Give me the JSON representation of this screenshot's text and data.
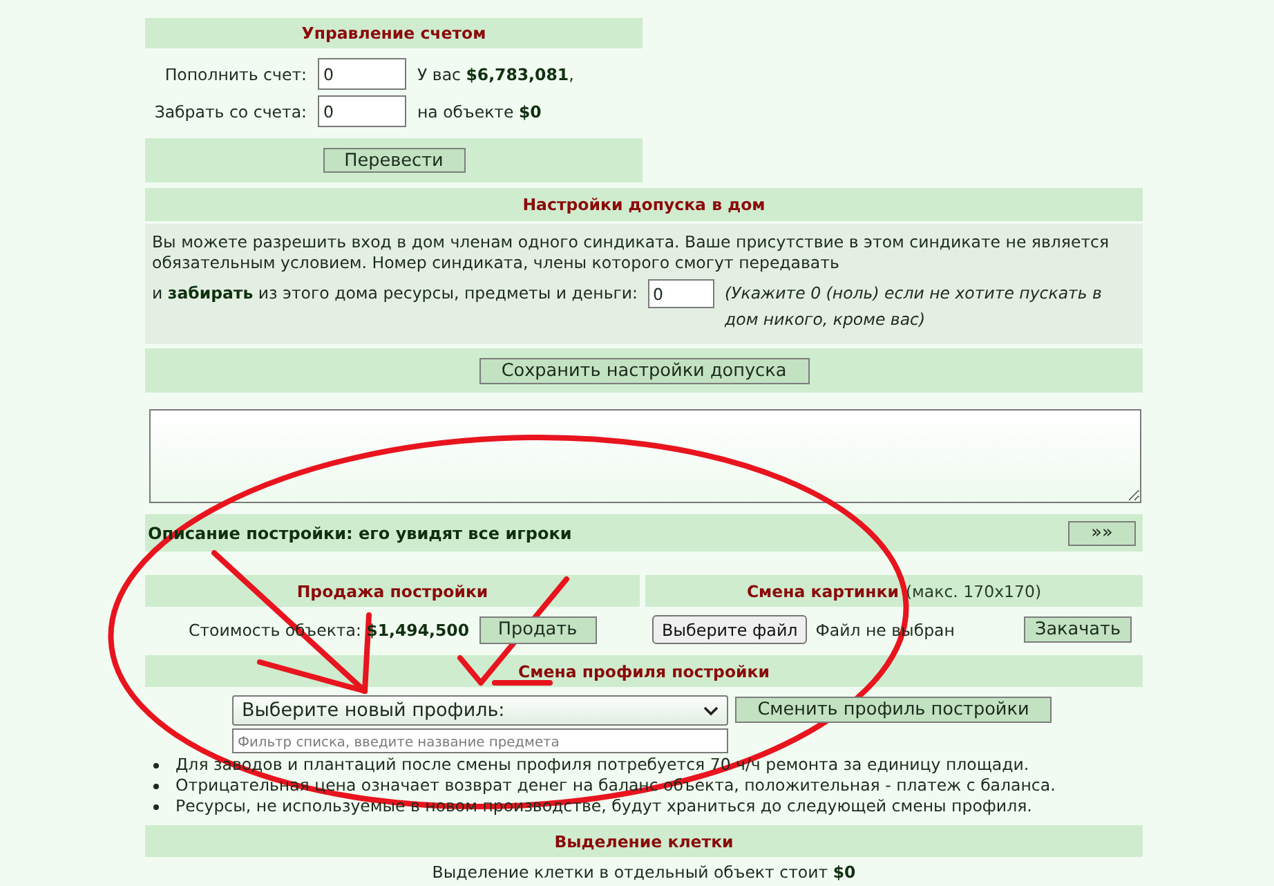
{
  "account": {
    "title": "Управление счетом",
    "fields": [
      {
        "label": "Пополнить счет:",
        "value": "0",
        "note": "У вас **$6,783,081**,"
      },
      {
        "label": "Забрать со счета:",
        "value": "0",
        "note": "на объекте **$0**"
      }
    ],
    "button": "Перевести"
  },
  "access": {
    "title": "Настройки допуска в дом",
    "intro": "Вы можете разрешить вход в дом членам одного синдиката. Ваше присутствие в этом синдикате не является обязательным условием. Номер синдиката, члены которого смогут передавать",
    "field_label": "и **забирать** из этого дома ресурсы, предметы и деньги:",
    "field_value": "0",
    "hint": "(Укажите 0 (ноль) если не хотите пускать в дом никого, кроме вас)",
    "button": "Сохранить настройки допуска"
  },
  "description": {
    "label": "Описание постройки: его увидят все игроки",
    "button": "»»"
  },
  "sale": {
    "title": "Продажа постройки",
    "price": "Стоимость объекта: **$1,494,500**",
    "button": "Продать"
  },
  "picture": {
    "title": "Смена картинки",
    "size_note": "(макс. 170x170)",
    "file_button": "Выберите файл",
    "file_status": "Файл не выбран",
    "upload_button": "Закачать"
  },
  "profile": {
    "title": "Смена профиля постройки",
    "select_value": "Выберите новый профиль:",
    "button": "Сменить профиль постройки",
    "filter_placeholder": "Фильтр списка, введите название предмета",
    "notes": [
      "Для заводов и плантаций после смены профиля потребуется 70 ч/ч ремонта за единицу площади.",
      "Отрицательная цена означает возврат денег на баланс объекта, положительная - платеж с баланса.",
      "Ресурсы, не используемые в новом производстве, будут храниться до следующей смены профиля."
    ]
  },
  "cell": {
    "title": "Выделение клетки",
    "text": "Выделение клетки в отдельный объект стоит **$0**"
  }
}
